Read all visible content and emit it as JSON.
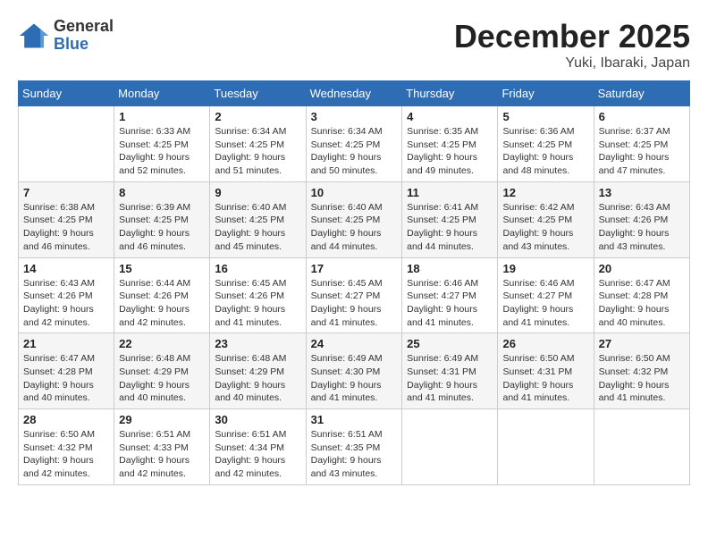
{
  "logo": {
    "general": "General",
    "blue": "Blue"
  },
  "title": "December 2025",
  "location": "Yuki, Ibaraki, Japan",
  "days_of_week": [
    "Sunday",
    "Monday",
    "Tuesday",
    "Wednesday",
    "Thursday",
    "Friday",
    "Saturday"
  ],
  "weeks": [
    [
      {
        "day": "",
        "info": ""
      },
      {
        "day": "1",
        "info": "Sunrise: 6:33 AM\nSunset: 4:25 PM\nDaylight: 9 hours\nand 52 minutes."
      },
      {
        "day": "2",
        "info": "Sunrise: 6:34 AM\nSunset: 4:25 PM\nDaylight: 9 hours\nand 51 minutes."
      },
      {
        "day": "3",
        "info": "Sunrise: 6:34 AM\nSunset: 4:25 PM\nDaylight: 9 hours\nand 50 minutes."
      },
      {
        "day": "4",
        "info": "Sunrise: 6:35 AM\nSunset: 4:25 PM\nDaylight: 9 hours\nand 49 minutes."
      },
      {
        "day": "5",
        "info": "Sunrise: 6:36 AM\nSunset: 4:25 PM\nDaylight: 9 hours\nand 48 minutes."
      },
      {
        "day": "6",
        "info": "Sunrise: 6:37 AM\nSunset: 4:25 PM\nDaylight: 9 hours\nand 47 minutes."
      }
    ],
    [
      {
        "day": "7",
        "info": "Sunrise: 6:38 AM\nSunset: 4:25 PM\nDaylight: 9 hours\nand 46 minutes."
      },
      {
        "day": "8",
        "info": "Sunrise: 6:39 AM\nSunset: 4:25 PM\nDaylight: 9 hours\nand 46 minutes."
      },
      {
        "day": "9",
        "info": "Sunrise: 6:40 AM\nSunset: 4:25 PM\nDaylight: 9 hours\nand 45 minutes."
      },
      {
        "day": "10",
        "info": "Sunrise: 6:40 AM\nSunset: 4:25 PM\nDaylight: 9 hours\nand 44 minutes."
      },
      {
        "day": "11",
        "info": "Sunrise: 6:41 AM\nSunset: 4:25 PM\nDaylight: 9 hours\nand 44 minutes."
      },
      {
        "day": "12",
        "info": "Sunrise: 6:42 AM\nSunset: 4:25 PM\nDaylight: 9 hours\nand 43 minutes."
      },
      {
        "day": "13",
        "info": "Sunrise: 6:43 AM\nSunset: 4:26 PM\nDaylight: 9 hours\nand 43 minutes."
      }
    ],
    [
      {
        "day": "14",
        "info": "Sunrise: 6:43 AM\nSunset: 4:26 PM\nDaylight: 9 hours\nand 42 minutes."
      },
      {
        "day": "15",
        "info": "Sunrise: 6:44 AM\nSunset: 4:26 PM\nDaylight: 9 hours\nand 42 minutes."
      },
      {
        "day": "16",
        "info": "Sunrise: 6:45 AM\nSunset: 4:26 PM\nDaylight: 9 hours\nand 41 minutes."
      },
      {
        "day": "17",
        "info": "Sunrise: 6:45 AM\nSunset: 4:27 PM\nDaylight: 9 hours\nand 41 minutes."
      },
      {
        "day": "18",
        "info": "Sunrise: 6:46 AM\nSunset: 4:27 PM\nDaylight: 9 hours\nand 41 minutes."
      },
      {
        "day": "19",
        "info": "Sunrise: 6:46 AM\nSunset: 4:27 PM\nDaylight: 9 hours\nand 41 minutes."
      },
      {
        "day": "20",
        "info": "Sunrise: 6:47 AM\nSunset: 4:28 PM\nDaylight: 9 hours\nand 40 minutes."
      }
    ],
    [
      {
        "day": "21",
        "info": "Sunrise: 6:47 AM\nSunset: 4:28 PM\nDaylight: 9 hours\nand 40 minutes."
      },
      {
        "day": "22",
        "info": "Sunrise: 6:48 AM\nSunset: 4:29 PM\nDaylight: 9 hours\nand 40 minutes."
      },
      {
        "day": "23",
        "info": "Sunrise: 6:48 AM\nSunset: 4:29 PM\nDaylight: 9 hours\nand 40 minutes."
      },
      {
        "day": "24",
        "info": "Sunrise: 6:49 AM\nSunset: 4:30 PM\nDaylight: 9 hours\nand 41 minutes."
      },
      {
        "day": "25",
        "info": "Sunrise: 6:49 AM\nSunset: 4:31 PM\nDaylight: 9 hours\nand 41 minutes."
      },
      {
        "day": "26",
        "info": "Sunrise: 6:50 AM\nSunset: 4:31 PM\nDaylight: 9 hours\nand 41 minutes."
      },
      {
        "day": "27",
        "info": "Sunrise: 6:50 AM\nSunset: 4:32 PM\nDaylight: 9 hours\nand 41 minutes."
      }
    ],
    [
      {
        "day": "28",
        "info": "Sunrise: 6:50 AM\nSunset: 4:32 PM\nDaylight: 9 hours\nand 42 minutes."
      },
      {
        "day": "29",
        "info": "Sunrise: 6:51 AM\nSunset: 4:33 PM\nDaylight: 9 hours\nand 42 minutes."
      },
      {
        "day": "30",
        "info": "Sunrise: 6:51 AM\nSunset: 4:34 PM\nDaylight: 9 hours\nand 42 minutes."
      },
      {
        "day": "31",
        "info": "Sunrise: 6:51 AM\nSunset: 4:35 PM\nDaylight: 9 hours\nand 43 minutes."
      },
      {
        "day": "",
        "info": ""
      },
      {
        "day": "",
        "info": ""
      },
      {
        "day": "",
        "info": ""
      }
    ]
  ]
}
